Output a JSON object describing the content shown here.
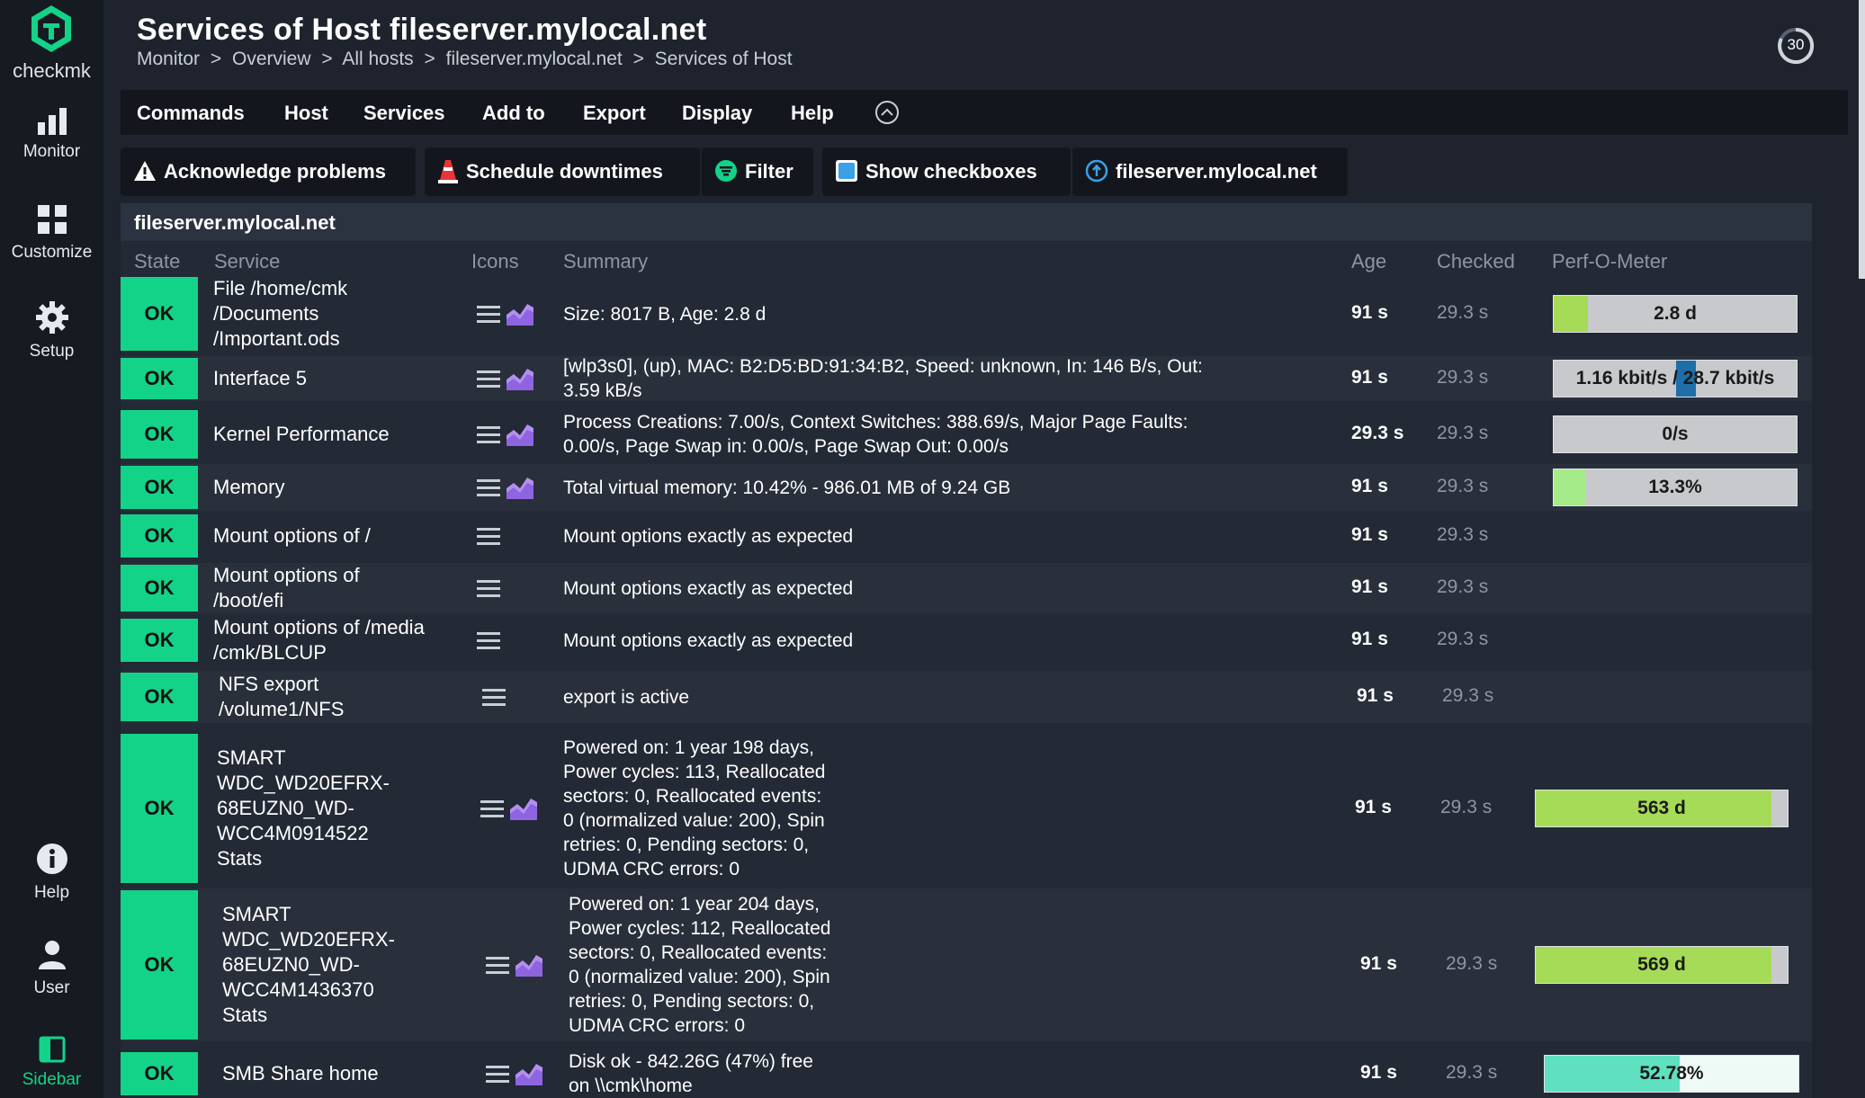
{
  "sidebar": {
    "logo_text": "checkmk",
    "items": [
      {
        "label": "Monitor",
        "icon": "bar-chart-icon"
      },
      {
        "label": "Customize",
        "icon": "grid-icon"
      },
      {
        "label": "Setup",
        "icon": "gear-icon"
      },
      {
        "label": "Help",
        "icon": "info-icon"
      },
      {
        "label": "User",
        "icon": "user-icon"
      },
      {
        "label": "Sidebar",
        "icon": "sidebar-icon"
      }
    ]
  },
  "header": {
    "title": "Services of Host fileserver.mylocal.net",
    "breadcrumb": [
      "Monitor",
      ">",
      "Overview",
      ">",
      "All hosts",
      ">",
      "fileserver.mylocal.net",
      ">",
      "Services of Host"
    ],
    "refresh_seconds": "30"
  },
  "menu": [
    "Commands",
    "Host",
    "Services",
    "Add to",
    "Export",
    "Display",
    "Help"
  ],
  "toolbar": {
    "acknowledge": "Acknowledge problems",
    "downtimes": "Schedule downtimes",
    "filter": "Filter",
    "checkboxes": "Show checkboxes",
    "host": "fileserver.mylocal.net"
  },
  "table": {
    "host": "fileserver.mylocal.net",
    "columns": [
      "State",
      "Service",
      "Icons",
      "Summary",
      "Age",
      "Checked",
      "Perf-O-Meter"
    ],
    "rows": [
      {
        "state": "OK",
        "service": [
          "File /home/cmk",
          "/Documents",
          "/Important.ods"
        ],
        "summary": [
          "Size: 8017 B, Age: 2.8 d"
        ],
        "age": "91 s",
        "checked": "29.3 s",
        "graph": true,
        "perf": {
          "text": "2.8 d",
          "fraction": 0.14,
          "color": "#a6db58"
        }
      },
      {
        "state": "OK",
        "service": [
          "Interface 5"
        ],
        "summary": [
          "[wlp3s0], (up), MAC: B2:D5:BD:91:34:B2, Speed: unknown, In: 146 B/s, Out:",
          "3.59 kB/s"
        ],
        "age": "91 s",
        "checked": "29.3 s",
        "graph": true,
        "perf": {
          "text": "1.16 kbit/s / 28.7 kbit/s",
          "fraction": 0.5,
          "color": "#1f6ea8"
        }
      },
      {
        "state": "OK",
        "service": [
          "Kernel Performance"
        ],
        "summary": [
          "Process Creations: 7.00/s, Context Switches: 388.69/s, Major Page Faults:",
          "0.00/s, Page Swap in: 0.00/s, Page Swap Out: 0.00/s"
        ],
        "age": "29.3 s",
        "checked": "29.3 s",
        "graph": true,
        "perf": {
          "text": "0/s",
          "fraction": 0.0,
          "color": "#a6db58"
        }
      },
      {
        "state": "OK",
        "service": [
          "Memory"
        ],
        "summary": [
          "Total virtual memory: 10.42% - 986.01 MB of 9.24 GB"
        ],
        "age": "91 s",
        "checked": "29.3 s",
        "graph": true,
        "perf": {
          "text": "13.3%",
          "fraction": 0.133,
          "color": "#a6eb8a"
        }
      },
      {
        "state": "OK",
        "service": [
          "Mount options of /"
        ],
        "summary": [
          "Mount options exactly as expected"
        ],
        "age": "91 s",
        "checked": "29.3 s",
        "graph": false,
        "perf": null
      },
      {
        "state": "OK",
        "service": [
          "Mount options of",
          "/boot/efi"
        ],
        "summary": [
          "Mount options exactly as expected"
        ],
        "age": "91 s",
        "checked": "29.3 s",
        "graph": false,
        "perf": null
      },
      {
        "state": "OK",
        "service": [
          "Mount options of /media",
          "/cmk/BLCUP"
        ],
        "summary": [
          "Mount options exactly as expected"
        ],
        "age": "91 s",
        "checked": "29.3 s",
        "graph": false,
        "perf": null
      },
      {
        "state": "OK",
        "service": [
          "NFS export",
          "/volume1/NFS"
        ],
        "summary": [
          "export is active"
        ],
        "age": "91 s",
        "checked": "29.3 s",
        "graph": false,
        "perf": null
      },
      {
        "state": "OK",
        "service": [
          "SMART",
          "WDC_WD20EFRX-",
          "68EUZN0_WD-",
          "WCC4M0914522",
          "Stats"
        ],
        "summary": [
          "Powered on: 1 year 198 days,",
          "Power cycles: 113, Reallocated",
          "sectors: 0, Reallocated events:",
          "0 (normalized value: 200), Spin",
          "retries: 0, Pending sectors: 0,",
          "UDMA CRC errors: 0"
        ],
        "age": "91 s",
        "checked": "29.3 s",
        "graph": true,
        "perf": {
          "text": "563 d",
          "fraction": 0.93,
          "color": "#a6db58"
        }
      },
      {
        "state": "OK",
        "service": [
          "SMART",
          "WDC_WD20EFRX-",
          "68EUZN0_WD-",
          "WCC4M1436370",
          "Stats"
        ],
        "summary": [
          "Powered on: 1 year 204 days,",
          "Power cycles: 112, Reallocated",
          "sectors: 0, Reallocated events:",
          "0 (normalized value: 200), Spin",
          "retries: 0, Pending sectors: 0,",
          "UDMA CRC errors: 0"
        ],
        "age": "91 s",
        "checked": "29.3 s",
        "graph": true,
        "perf": {
          "text": "569 d",
          "fraction": 0.93,
          "color": "#a6db58"
        }
      },
      {
        "state": "OK",
        "service": [
          "SMB Share home"
        ],
        "summary": [
          "Disk ok - 842.26G (47%) free",
          "on \\\\cmk\\home"
        ],
        "age": "91 s",
        "checked": "29.3 s",
        "graph": true,
        "perf": {
          "text": "52.78%",
          "fraction": 0.5278,
          "color": "#5fe0c0"
        }
      }
    ]
  }
}
